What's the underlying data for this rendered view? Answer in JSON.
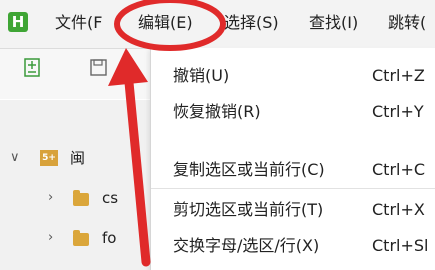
{
  "app": {
    "icon_letter": "H"
  },
  "menubar": {
    "items": [
      {
        "label": "文件(F"
      },
      {
        "label": "编辑(E)"
      },
      {
        "label": "选择(S)"
      },
      {
        "label": "查找(I)"
      },
      {
        "label": "跳转("
      }
    ],
    "active_index": 1
  },
  "toolbar": {
    "icons": [
      "new-file-icon",
      "save-icon"
    ]
  },
  "sidebar": {
    "project": {
      "badge": "5+",
      "label": "闽"
    },
    "folders": [
      {
        "label": "cs"
      },
      {
        "label": "fo"
      }
    ]
  },
  "edit_menu": {
    "items": [
      {
        "label": "撤销(U)",
        "shortcut": "Ctrl+Z"
      },
      {
        "label": "恢复撤销(R)",
        "shortcut": "Ctrl+Y"
      },
      {
        "label": "复制选区或当前行(C)",
        "shortcut": "Ctrl+C"
      },
      {
        "label": "剪切选区或当前行(T)",
        "shortcut": "Ctrl+X"
      },
      {
        "label": "交换字母/选区/行(X)",
        "shortcut": "Ctrl+Sl"
      }
    ]
  },
  "annotation": {
    "circle_color": "#e02a2a",
    "arrow_color": "#e02a2a"
  }
}
